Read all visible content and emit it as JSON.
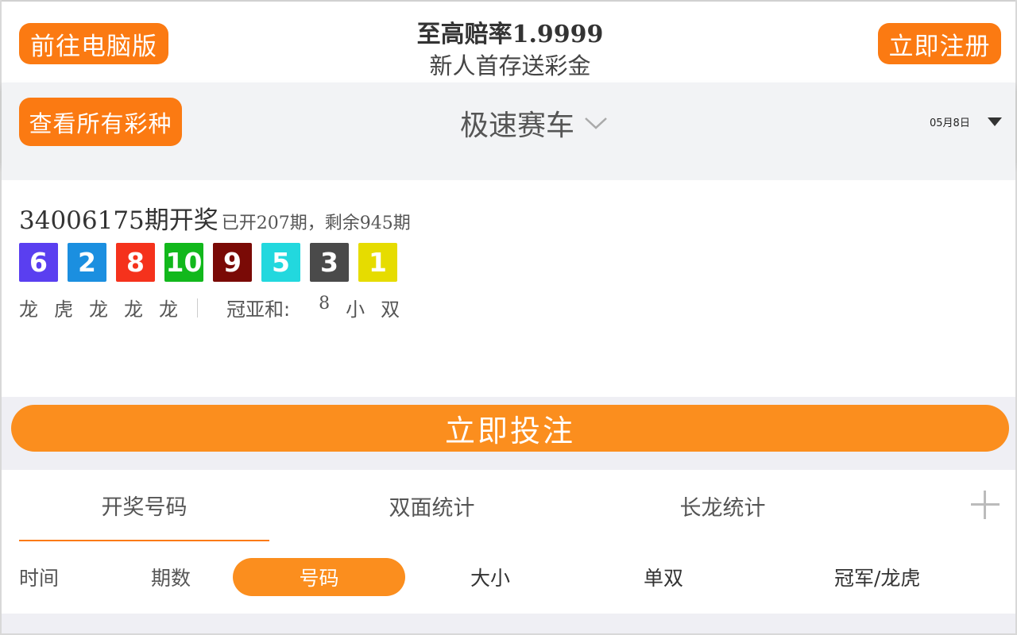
{
  "header": {
    "pc_button": "前往电脑版",
    "promo_title": "至高赔率1.9999",
    "promo_subtitle": "新人首存送彩金",
    "register_button": "立即注册"
  },
  "game_bar": {
    "all_lottery_button": "查看所有彩种",
    "game_name": "极速赛车",
    "date": "05月8日"
  },
  "result": {
    "period_title": "34006175期开奖",
    "period_info": "已开207期，剩余945期",
    "balls": [
      {
        "num": "6",
        "color": "#5a3ff0"
      },
      {
        "num": "2",
        "color": "#1b8fe0"
      },
      {
        "num": "8",
        "color": "#f5321c"
      },
      {
        "num": "10",
        "color": "#12b81c"
      },
      {
        "num": "9",
        "color": "#7a0a06"
      },
      {
        "num": "5",
        "color": "#22d8de"
      },
      {
        "num": "3",
        "color": "#4a4a4a"
      },
      {
        "num": "1",
        "color": "#e6dc00"
      }
    ],
    "dragon_tiger": [
      "龙",
      "虎",
      "龙",
      "龙",
      "龙"
    ],
    "sum_label": "冠亚和:",
    "sum_value": "8",
    "size": "小",
    "parity": "双"
  },
  "bet_button": "立即投注",
  "tabs": [
    {
      "label": "开奖号码"
    },
    {
      "label": "双面统计"
    },
    {
      "label": "长龙统计"
    }
  ],
  "filters": [
    {
      "label": "时间"
    },
    {
      "label": "期数"
    },
    {
      "label": "号码"
    },
    {
      "label": "大小"
    },
    {
      "label": "单双"
    },
    {
      "label": "冠军/龙虎"
    }
  ],
  "colors": {
    "accent": "#fb7a12",
    "bet_button": "#fb8e1e"
  }
}
